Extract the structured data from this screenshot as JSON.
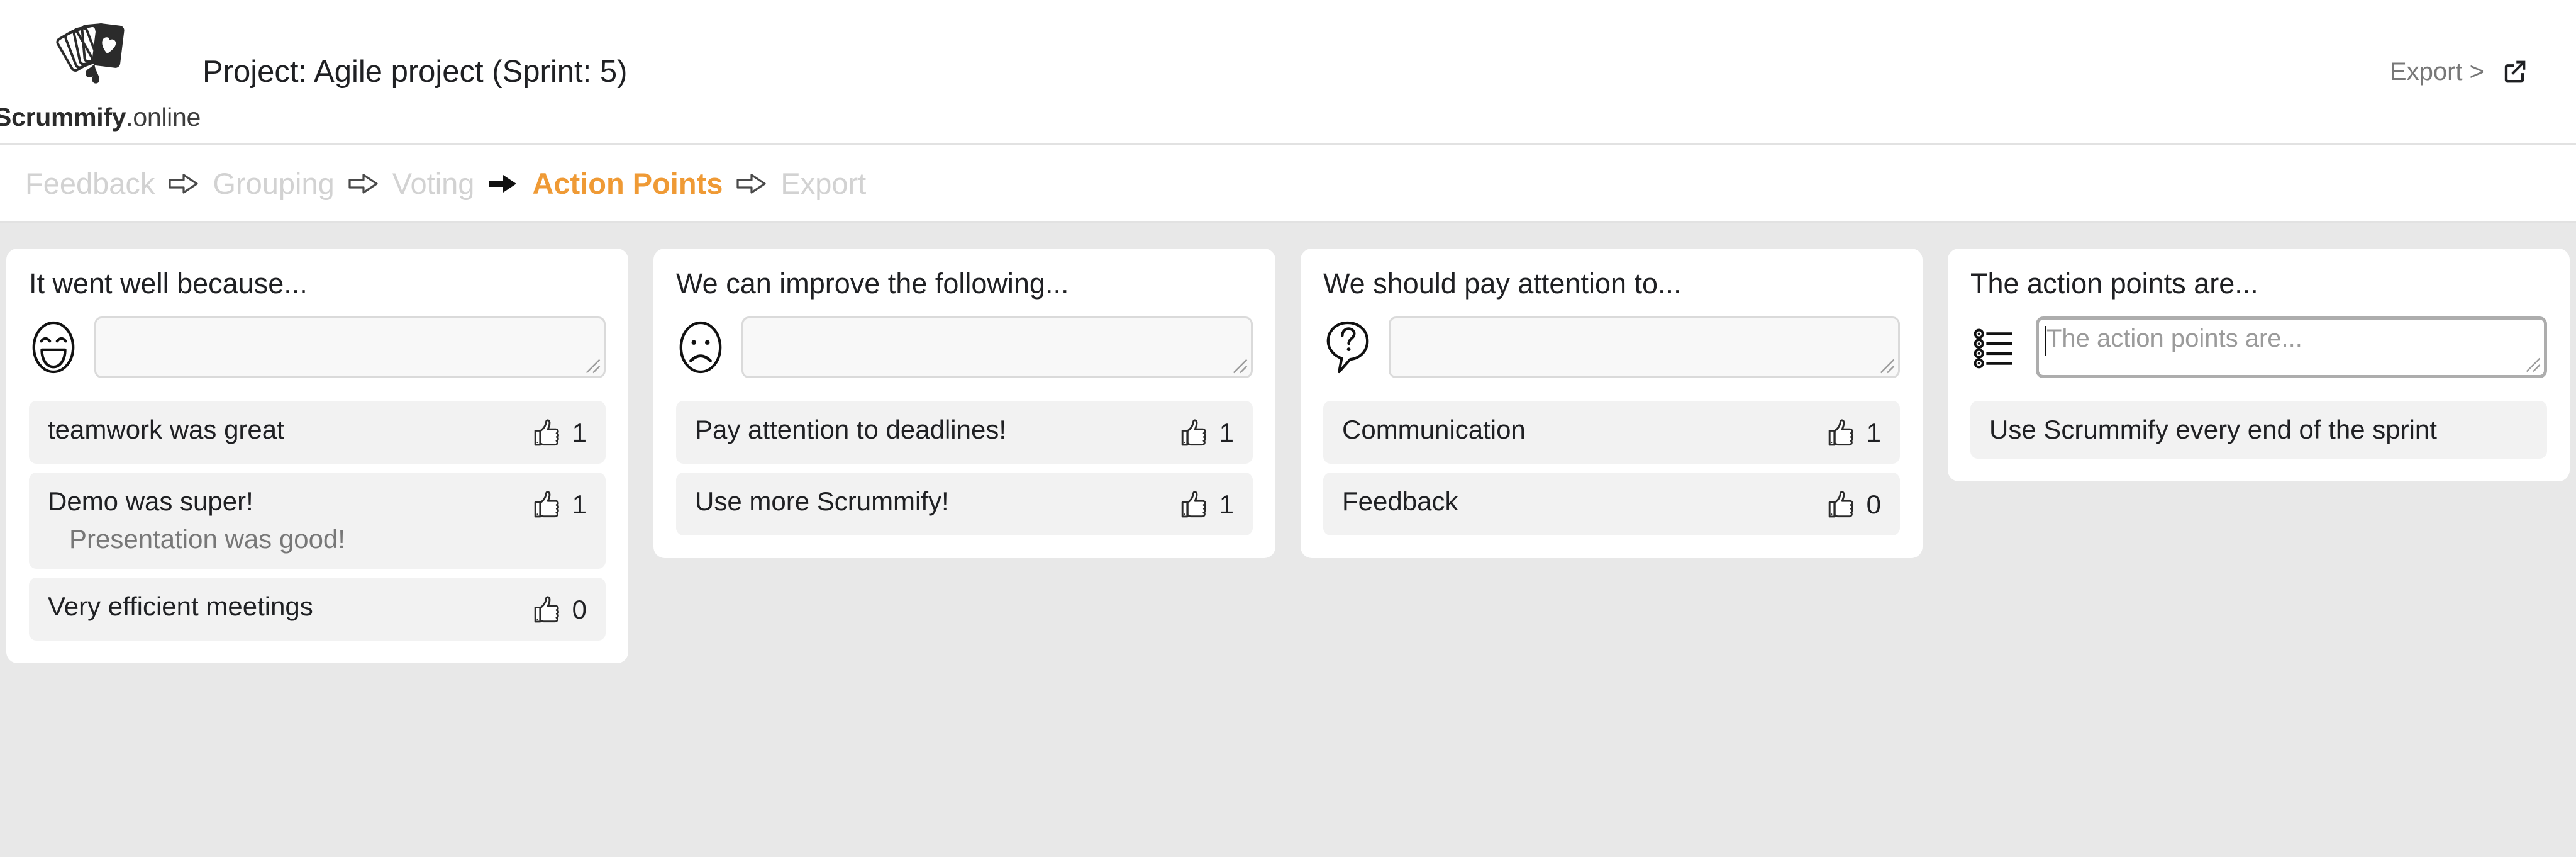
{
  "brand": {
    "name_bold": "Scrummify",
    "name_light": ".online",
    "logo_icon": "playing-cards-heart-logo"
  },
  "header": {
    "project_title": "Project: Agile project (Sprint: 5)",
    "export_label": "Export >",
    "export_icon": "external-link-icon"
  },
  "nav": {
    "steps": [
      {
        "label": "Feedback",
        "state": "done"
      },
      {
        "label": "Grouping",
        "state": "done"
      },
      {
        "label": "Voting",
        "state": "done"
      },
      {
        "label": "Action Points",
        "state": "active"
      },
      {
        "label": "Export",
        "state": "upcoming"
      }
    ],
    "arrows": [
      {
        "style": "hollow"
      },
      {
        "style": "hollow"
      },
      {
        "style": "solid"
      },
      {
        "style": "hollow"
      }
    ]
  },
  "colors": {
    "accent_orange": "#ef9a35",
    "nav_inactive": "#d2d2d2",
    "page_background": "#e8e8e8",
    "card_background": "#ffffff",
    "item_background": "#f2f2f2",
    "text_primary": "#1f2023",
    "text_muted": "#777777"
  },
  "columns": [
    {
      "title": "It went well because...",
      "icon": "happy-face-icon",
      "input": {
        "placeholder": "",
        "value": "",
        "focused": false
      },
      "items": [
        {
          "text": "teamwork was great",
          "subtext": "",
          "votes": "1",
          "has_votes": true
        },
        {
          "text": "Demo was super!",
          "subtext": "Presentation was good!",
          "votes": "1",
          "has_votes": true
        },
        {
          "text": "Very efficient meetings",
          "subtext": "",
          "votes": "0",
          "has_votes": true
        }
      ]
    },
    {
      "title": "We can improve the following...",
      "icon": "sad-face-icon",
      "input": {
        "placeholder": "",
        "value": "",
        "focused": false
      },
      "items": [
        {
          "text": "Pay attention to deadlines!",
          "subtext": "",
          "votes": "1",
          "has_votes": true
        },
        {
          "text": "Use more Scrummify!",
          "subtext": "",
          "votes": "1",
          "has_votes": true
        }
      ]
    },
    {
      "title": "We should pay attention to...",
      "icon": "question-speech-bubble-icon",
      "input": {
        "placeholder": "",
        "value": "",
        "focused": false
      },
      "items": [
        {
          "text": "Communication",
          "subtext": "",
          "votes": "1",
          "has_votes": true
        },
        {
          "text": "Feedback",
          "subtext": "",
          "votes": "0",
          "has_votes": true
        }
      ]
    },
    {
      "title": "The action points are...",
      "icon": "bullet-list-icon",
      "input": {
        "placeholder": "The action points are...",
        "value": "",
        "focused": true
      },
      "items": [
        {
          "text": "Use Scrummify every end of the sprint",
          "subtext": "",
          "votes": "",
          "has_votes": false
        }
      ]
    }
  ]
}
